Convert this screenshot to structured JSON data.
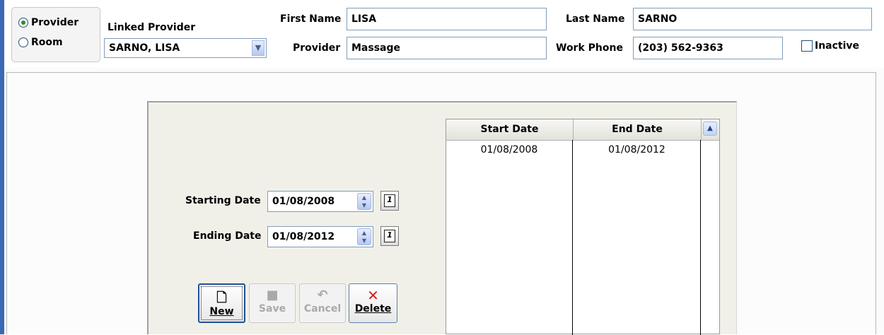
{
  "header": {
    "type_options": [
      {
        "label": "Provider",
        "selected": true
      },
      {
        "label": "Room",
        "selected": false
      }
    ],
    "linked_provider_label": "Linked Provider",
    "linked_provider_value": "SARNO, LISA",
    "first_name_label": "First Name",
    "first_name_value": "LISA",
    "last_name_label": "Last Name",
    "last_name_value": "SARNO",
    "provider_label": "Provider",
    "provider_value": "Massage",
    "work_phone_label": "Work Phone",
    "work_phone_value": "(203) 562-9363",
    "inactive_label": "Inactive",
    "inactive_checked": false
  },
  "dates": {
    "starting_label": "Starting Date",
    "starting_value": "01/08/2008",
    "ending_label": "Ending Date",
    "ending_value": "01/08/2012"
  },
  "buttons": {
    "new_label": "New",
    "save_label": "Save",
    "cancel_label": "Cancel",
    "delete_label": "Delete"
  },
  "table": {
    "columns": [
      "Start Date",
      "End Date"
    ],
    "rows": [
      [
        "01/08/2008",
        "01/08/2012"
      ]
    ]
  },
  "colors": {
    "window_border": "#3a6ab5",
    "field_border": "#7f9db9",
    "delete_icon": "#d42020"
  }
}
